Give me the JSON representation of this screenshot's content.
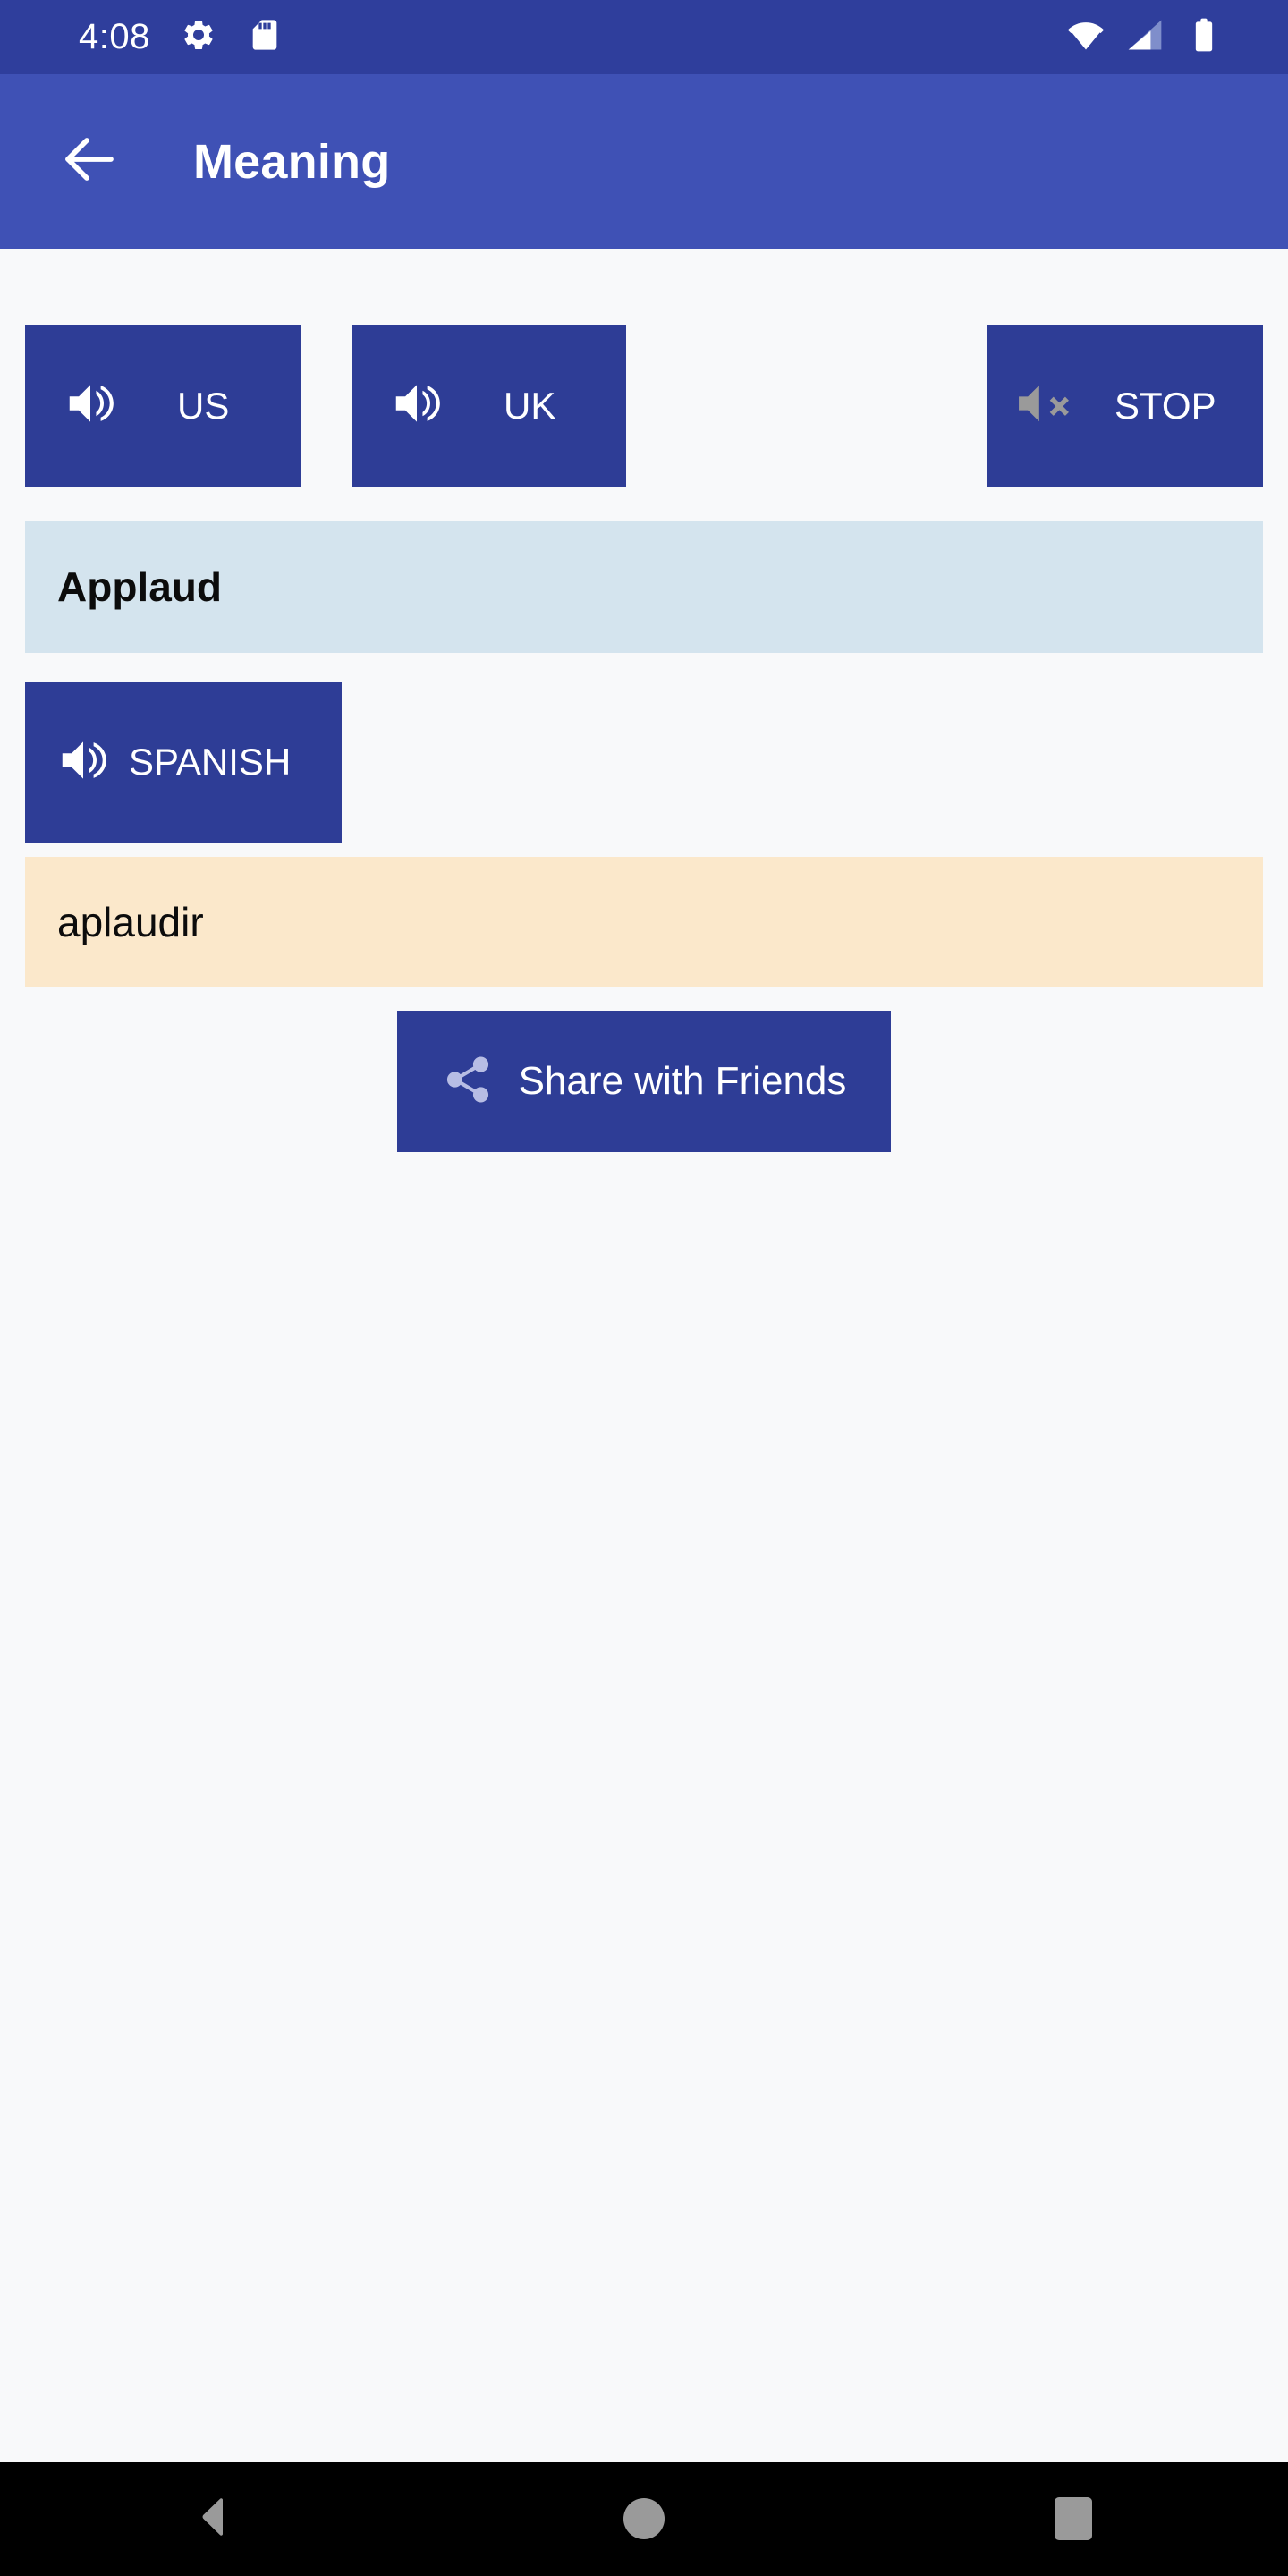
{
  "status_bar": {
    "time": "4:08",
    "icons": [
      "gear-icon",
      "sd-card-icon",
      "wifi-icon",
      "cellular-signal-icon",
      "battery-icon"
    ],
    "background_color": "#2f3e9c"
  },
  "app_bar": {
    "title": "Meaning",
    "back_label": "back-arrow-icon",
    "background_color": "#3f51b5"
  },
  "content": {
    "background_color": "#f8f9fa",
    "pronunciation_buttons": [
      {
        "label": "US",
        "icon": "volume-up-icon"
      },
      {
        "label": "UK",
        "icon": "volume-up-icon"
      }
    ],
    "stop_button": {
      "label": "STOP",
      "icon": "volume-mute-icon"
    },
    "word_card": {
      "text": "Applaud",
      "background_color": "#d4e4ee"
    },
    "translate_button": {
      "label": "SPANISH",
      "icon": "volume-up-icon"
    },
    "translation_card": {
      "text": "aplaudir",
      "background_color": "#fbe8cb"
    },
    "share_button": {
      "label": "Share with Friends",
      "icon": "share-icon"
    },
    "button_color": "#2e3d96"
  },
  "nav_bar": {
    "background_color": "#000000",
    "items": [
      {
        "name": "back",
        "icon": "triangle-back-icon"
      },
      {
        "name": "home",
        "icon": "circle-home-icon"
      },
      {
        "name": "recents",
        "icon": "square-recents-icon"
      }
    ]
  }
}
